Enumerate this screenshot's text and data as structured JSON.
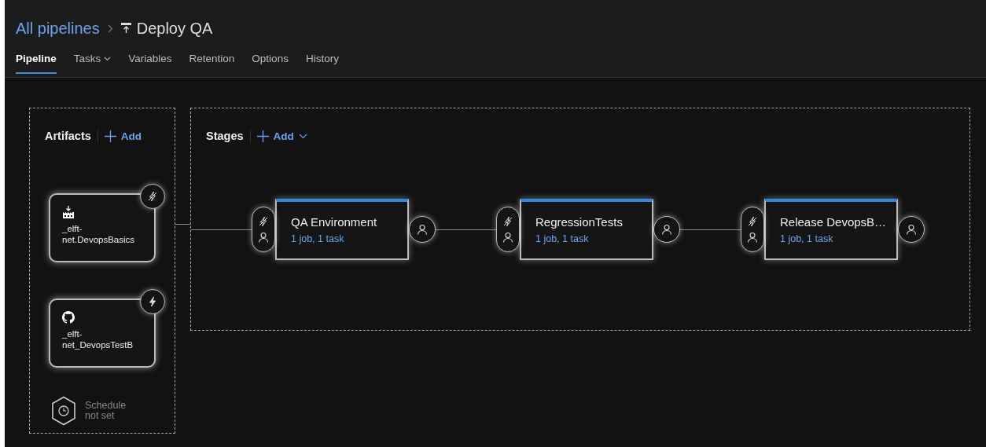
{
  "breadcrumb": {
    "parent": "All pipelines",
    "title": "Deploy QA"
  },
  "tabs": [
    {
      "label": "Pipeline",
      "selected": true,
      "dropdown": false
    },
    {
      "label": "Tasks",
      "selected": false,
      "dropdown": true
    },
    {
      "label": "Variables",
      "selected": false,
      "dropdown": false
    },
    {
      "label": "Retention",
      "selected": false,
      "dropdown": false
    },
    {
      "label": "Options",
      "selected": false,
      "dropdown": false
    },
    {
      "label": "History",
      "selected": false,
      "dropdown": false
    }
  ],
  "artifacts": {
    "title": "Artifacts",
    "add_label": "Add",
    "items": [
      {
        "kind": "build",
        "name": "_elft-net.DevopsBasics",
        "trigger_enabled": false
      },
      {
        "kind": "github",
        "name": "_elft-net_DevopsTestB",
        "trigger_enabled": true
      }
    ],
    "schedule": "Schedule not set"
  },
  "stages": {
    "title": "Stages",
    "add_label": "Add",
    "items": [
      {
        "name": "QA Environment",
        "summary": "1 job, 1 task",
        "trigger_enabled": false
      },
      {
        "name": "RegressionTests",
        "summary": "1 job, 1 task",
        "trigger_enabled": false
      },
      {
        "name": "Release DevopsB…",
        "summary": "1 job, 1 task",
        "trigger_enabled": false
      }
    ]
  }
}
